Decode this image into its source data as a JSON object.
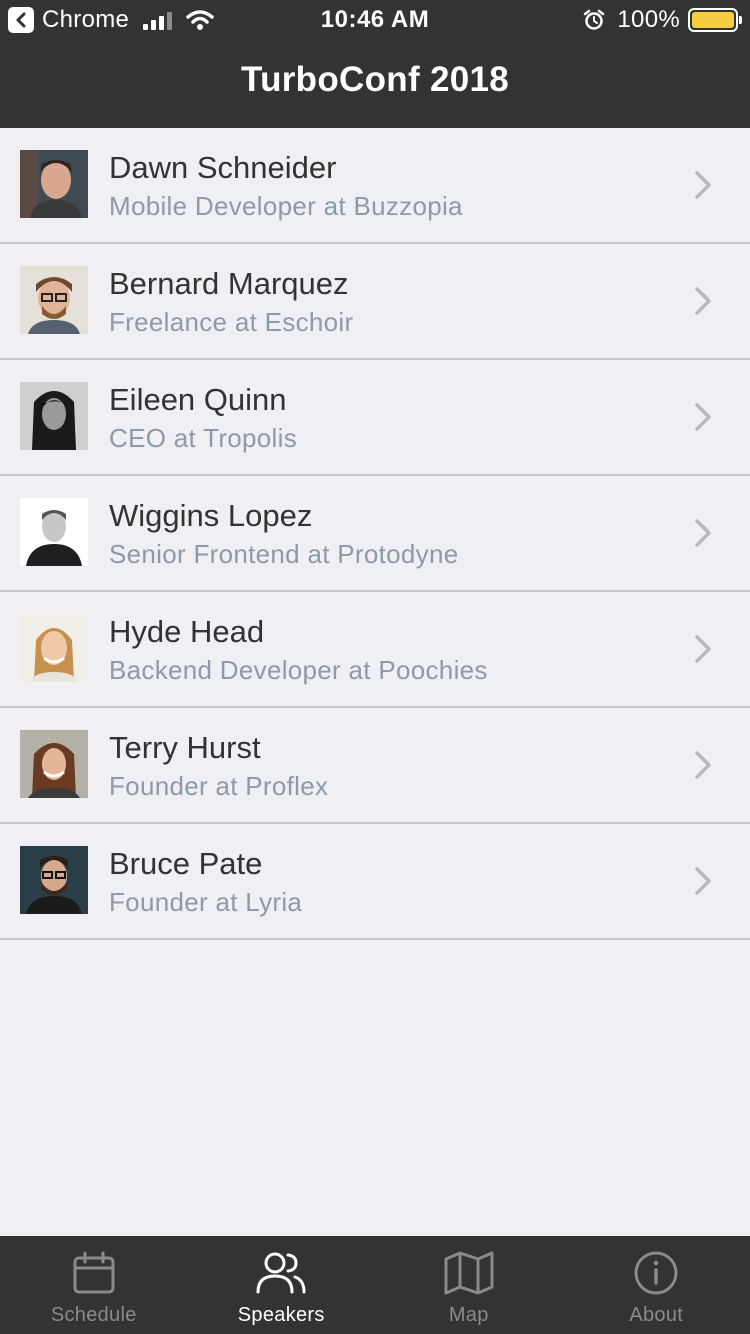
{
  "status_bar": {
    "back_app": "Chrome",
    "time": "10:46 AM",
    "battery": "100%",
    "battery_level": 1.0,
    "battery_color": "#f4cd40"
  },
  "nav": {
    "title": "TurboConf 2018"
  },
  "speakers": [
    {
      "name": "Dawn Schneider",
      "role": "Mobile Developer at Buzzopia"
    },
    {
      "name": "Bernard Marquez",
      "role": "Freelance at Eschoir"
    },
    {
      "name": "Eileen Quinn",
      "role": "CEO at Tropolis"
    },
    {
      "name": "Wiggins Lopez",
      "role": "Senior Frontend at Protodyne"
    },
    {
      "name": "Hyde Head",
      "role": "Backend Developer at Poochies"
    },
    {
      "name": "Terry Hurst",
      "role": "Founder at Proflex"
    },
    {
      "name": "Bruce Pate",
      "role": "Founder at Lyria"
    }
  ],
  "tabs": [
    {
      "label": "Schedule",
      "icon": "calendar-icon",
      "active": false
    },
    {
      "label": "Speakers",
      "icon": "people-icon",
      "active": true
    },
    {
      "label": "Map",
      "icon": "map-icon",
      "active": false
    },
    {
      "label": "About",
      "icon": "info-icon",
      "active": false
    }
  ],
  "colors": {
    "bar_background": "#333333",
    "list_background": "#efeff4",
    "role_text": "#8e9aa6",
    "tab_inactive": "#8a8a8a",
    "tab_active": "#ffffff"
  }
}
